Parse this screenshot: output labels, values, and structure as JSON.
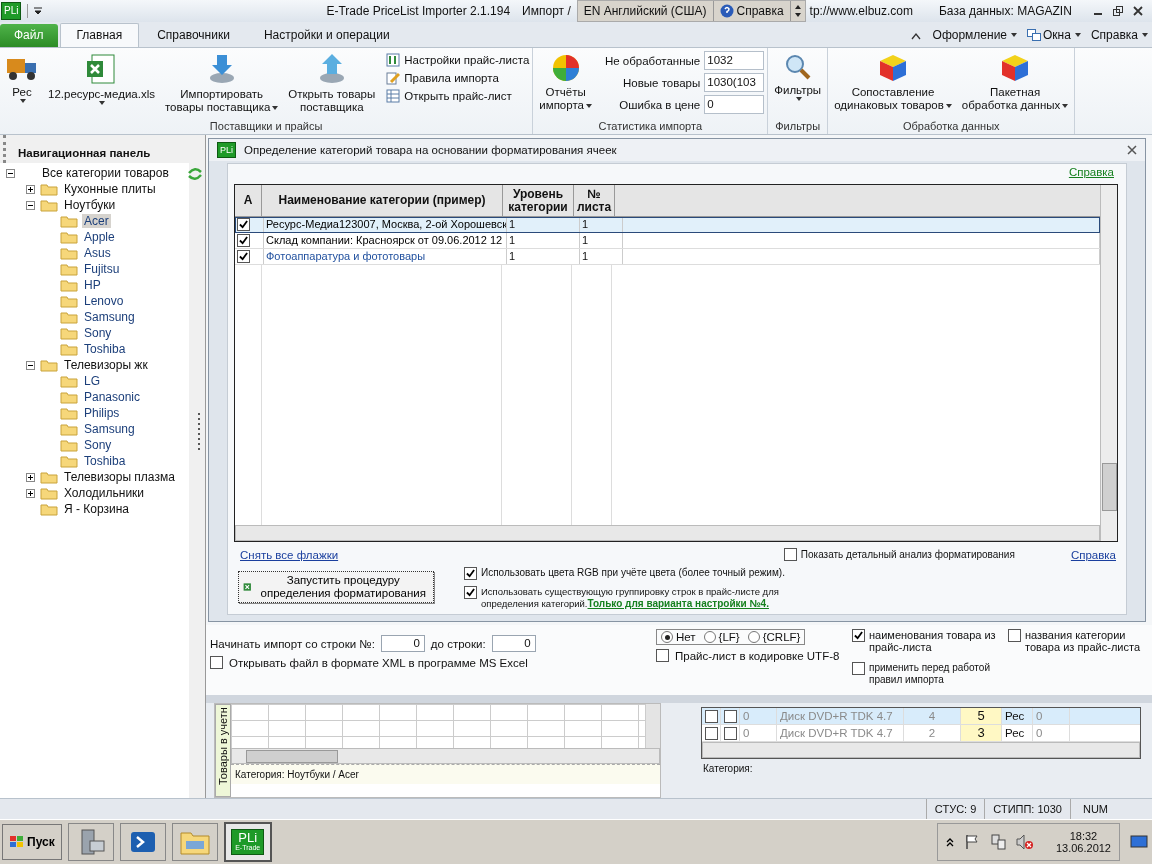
{
  "title_bar": {
    "app_badge": "PLi",
    "title": "E-Trade PriceList Importer 2.1.194",
    "breadcrumb": "Импорт /",
    "language": "EN Английский (США)",
    "help": "Справка",
    "url": "tp://www.elbuz.com",
    "database": "База данных: MAGAZIN"
  },
  "tabs": [
    {
      "label": "Файл",
      "kind": "file",
      "selected": false
    },
    {
      "label": "Главная",
      "kind": "tab",
      "selected": true
    },
    {
      "label": "Справочники",
      "kind": "tab",
      "selected": false
    },
    {
      "label": "Настройки и операции",
      "kind": "tab",
      "selected": false
    }
  ],
  "tab_menus": [
    {
      "label": "Оформление"
    },
    {
      "label": "Окна"
    },
    {
      "label": "Справка"
    }
  ],
  "ribbon": [
    {
      "label": "Поставщики и прайсы",
      "large_buttons": [
        {
          "lines": [
            "Рес"
          ],
          "dropdown": true
        },
        {
          "lines": [
            "12.ресурс-медиа.xls"
          ],
          "dropdown": true
        },
        {
          "lines": [
            "Импортировать",
            "товары поставщика"
          ],
          "dropdown": true
        },
        {
          "lines": [
            "Открыть товары",
            "поставщика"
          ],
          "dropdown": false
        }
      ],
      "small_buttons": [
        {
          "label": "Настройки прайс-листа"
        },
        {
          "label": "Правила импорта"
        },
        {
          "label": "Открыть прайс-лист"
        }
      ]
    },
    {
      "label": "Статистика импорта",
      "large_buttons": [
        {
          "lines": [
            "Отчёты",
            "импорта"
          ],
          "dropdown": true
        }
      ],
      "stats": [
        {
          "label": "Не обработанные",
          "value": "1032"
        },
        {
          "label": "Новые товары",
          "value": "1030(103"
        },
        {
          "label": "Ошибка в цене",
          "value": "0"
        }
      ]
    },
    {
      "label": "Фильтры",
      "large_buttons": [
        {
          "lines": [
            "Фильтры"
          ],
          "dropdown": true
        }
      ]
    },
    {
      "label": "Обработка данных",
      "large_buttons": [
        {
          "lines": [
            "Сопоставление",
            "одинаковых товаров"
          ],
          "dropdown": true
        },
        {
          "lines": [
            "Пакетная",
            "обработка данных"
          ],
          "dropdown": true
        }
      ]
    }
  ],
  "nav": {
    "title": "Навигационная панель",
    "tree": [
      {
        "label": "Все категории товаров",
        "expanded": true,
        "selected": false,
        "children": [
          {
            "label": "Кухонные плиты",
            "expanded": false,
            "selected": false
          },
          {
            "label": "Ноутбуки",
            "expanded": true,
            "selected": false,
            "children": [
              {
                "label": "Acer",
                "selected": true
              },
              {
                "label": "Apple",
                "selected": false
              },
              {
                "label": "Asus",
                "selected": false
              },
              {
                "label": "Fujitsu",
                "selected": false
              },
              {
                "label": "HP",
                "selected": false
              },
              {
                "label": "Lenovo",
                "selected": false
              },
              {
                "label": "Samsung",
                "selected": false
              },
              {
                "label": "Sony",
                "selected": false
              },
              {
                "label": "Toshiba",
                "selected": false
              }
            ]
          },
          {
            "label": "Телевизоры жк",
            "expanded": true,
            "selected": false,
            "children": [
              {
                "label": "LG",
                "selected": false
              },
              {
                "label": "Panasonic",
                "selected": false
              },
              {
                "label": "Philips",
                "selected": false
              },
              {
                "label": "Samsung",
                "selected": false
              },
              {
                "label": "Sony",
                "selected": false
              },
              {
                "label": "Toshiba",
                "selected": false
              }
            ]
          },
          {
            "label": "Телевизоры плазма",
            "expanded": false,
            "selected": false
          },
          {
            "label": "Холодильники",
            "expanded": false,
            "selected": false
          },
          {
            "label": "Я - Корзина",
            "selected": false
          }
        ]
      }
    ]
  },
  "dialog": {
    "app_badge": "PLi",
    "title": "Определение категорий товара на основании форматирования ячеек",
    "help_top": "Справка",
    "columns": [
      "A",
      "Наименование категории (пример)",
      "Уровень категории",
      "№ листа"
    ],
    "rows": [
      {
        "checked": true,
        "selected": true,
        "color": "#000000",
        "name": "Ресурс-Медиа123007, Москва, 2-ой Хорошевск",
        "level": "1",
        "sheet": "1"
      },
      {
        "checked": true,
        "selected": false,
        "color": "#000000",
        "name": "Склад компании: Красноярск от 09.06.2012 12",
        "level": "1",
        "sheet": "1"
      },
      {
        "checked": true,
        "selected": false,
        "color": "#1f4f9e",
        "name": "Фотоаппаратура и фототовары",
        "level": "1",
        "sheet": "1"
      }
    ],
    "clear_link": "Снять все флажки",
    "detail_option": {
      "label": "Показать детальный анализ форматирования",
      "checked": false
    },
    "help_bottom": "Справка",
    "run_button": "Запустить процедуру определения форматирования",
    "options": [
      {
        "label": "Использовать цвета RGB при учёте цвета (более точный режим).",
        "checked": true
      },
      {
        "label": "Использовать существующую группировку строк в прайс-листе для определения категорий.",
        "checked": true,
        "link": "Только для варианта настройки №4."
      }
    ]
  },
  "form": {
    "start_label": "Начинать импорт со строки №:",
    "start_value": "0",
    "end_label": "до строки:",
    "end_value": "0",
    "xml_option": {
      "label": "Открывать файл в формате XML в программе MS Excel",
      "checked": false
    },
    "line_breaks": [
      {
        "label": "Нет",
        "selected": true
      },
      {
        "label": "{LF}",
        "selected": false
      },
      {
        "label": "{CRLF}",
        "selected": false
      }
    ],
    "utf8_option": {
      "label": "Прайс-лист в кодировке UTF-8",
      "checked": false
    },
    "right_options": [
      {
        "label": "наименования товара из прайс-листа",
        "checked": true
      },
      {
        "label": "названия категории товара из прайс-листа",
        "checked": false
      },
      {
        "label": "применить перед работой правил импорта",
        "checked": false
      }
    ]
  },
  "left_grid": {
    "tab": "Товары в учетн",
    "footer": "Категория: Ноутбуки / Acer"
  },
  "right_grid": {
    "rows": [
      {
        "selected": true,
        "check_1": false,
        "check_2": false,
        "code": "0",
        "name": "Диск DVD+R TDK 4.7",
        "count": "4",
        "score": "5",
        "supplier": "Рес",
        "extra": "0"
      },
      {
        "selected": false,
        "check_1": false,
        "check_2": false,
        "code": "0",
        "name": "Диск DVD+R TDK 4.7",
        "count": "2",
        "score": "3",
        "supplier": "Рес",
        "extra": "0"
      }
    ],
    "footer": "Категория:"
  },
  "status_bar": [
    "СТУС: 9",
    "СТИПП: 1030",
    "NUM"
  ],
  "taskbar": {
    "start": "Пуск",
    "app_badge": "PLi",
    "app_caption": "E-Trade",
    "time": "18:32",
    "date": "13.06.2012"
  }
}
